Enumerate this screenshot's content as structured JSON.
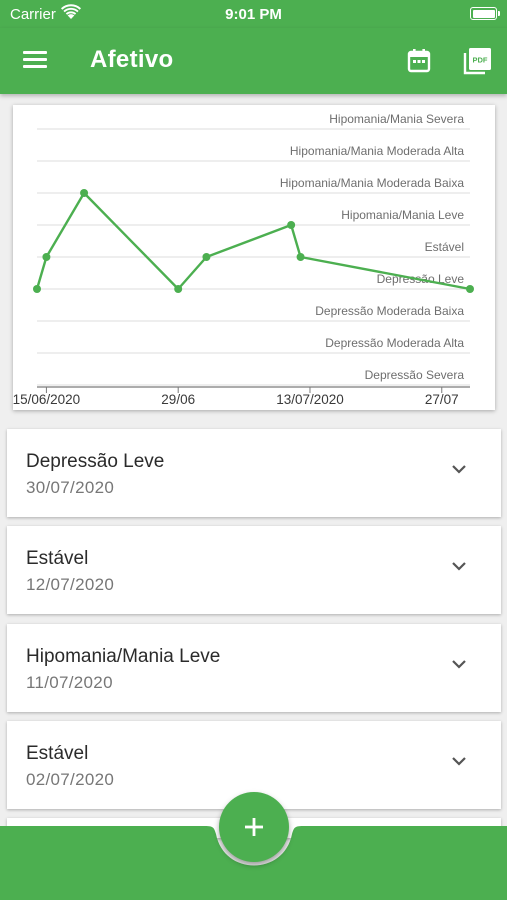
{
  "status": {
    "carrier": "Carrier",
    "time": "9:01 PM"
  },
  "app_bar": {
    "title": "Afetivo"
  },
  "colors": {
    "primary": "#4caf50",
    "line": "#4caf50"
  },
  "chart_data": {
    "type": "line",
    "y_categories": [
      "Depressão Severa",
      "Depressão Moderada Alta",
      "Depressão Moderada Baixa",
      "Depressão Leve",
      "Estável",
      "Hipomania/Mania Leve",
      "Hipomania/Mania Moderada Baixa",
      "Hipomania/Mania Moderada Alta",
      "Hipomania/Mania Severa"
    ],
    "x_tick_labels": [
      "15/06/2020",
      "29/06",
      "13/07/2020",
      "27/07"
    ],
    "x_range": [
      "2020-06-14",
      "2020-07-30"
    ],
    "series": [
      {
        "points": [
          {
            "x": "2020-06-14",
            "y": "Depressão Leve"
          },
          {
            "x": "2020-06-15",
            "y": "Estável"
          },
          {
            "x": "2020-06-19",
            "y": "Hipomania/Mania Moderada Baixa"
          },
          {
            "x": "2020-06-29",
            "y": "Depressão Leve"
          },
          {
            "x": "2020-07-02",
            "y": "Estável"
          },
          {
            "x": "2020-07-11",
            "y": "Hipomania/Mania Leve"
          },
          {
            "x": "2020-07-12",
            "y": "Estável"
          },
          {
            "x": "2020-07-30",
            "y": "Depressão Leve"
          }
        ]
      }
    ],
    "grid": true
  },
  "entries": [
    {
      "title": "Depressão Leve",
      "date": "30/07/2020"
    },
    {
      "title": "Estável",
      "date": "12/07/2020"
    },
    {
      "title": "Hipomania/Mania Leve",
      "date": "11/07/2020"
    },
    {
      "title": "Estável",
      "date": "02/07/2020"
    }
  ],
  "icons": {
    "menu": "menu-icon",
    "calendar": "calendar-icon",
    "pdf": "pdf-icon",
    "expand": "chevron-down-icon",
    "add": "plus-icon"
  }
}
